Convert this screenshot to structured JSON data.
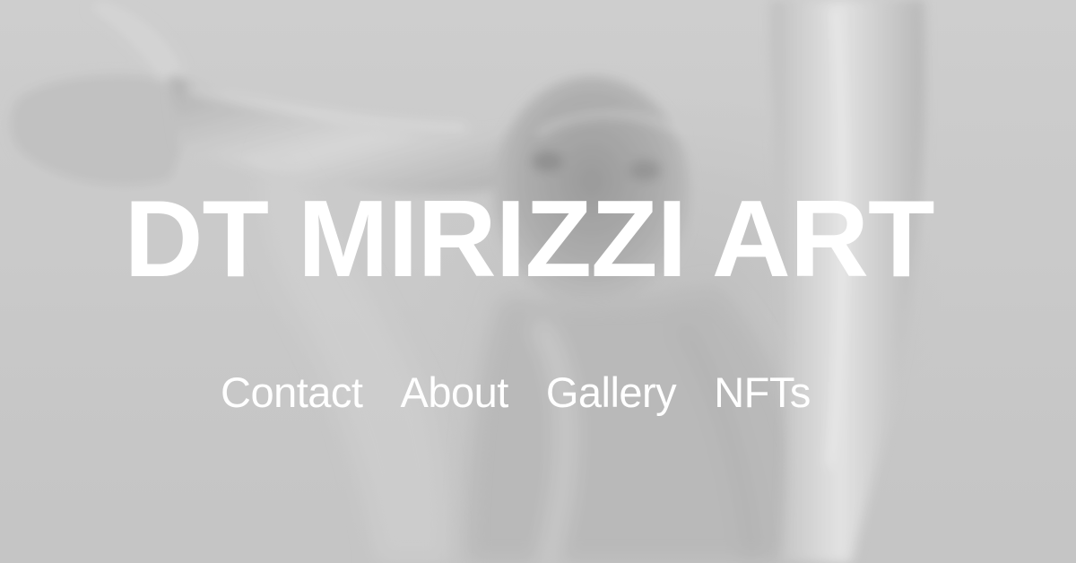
{
  "site": {
    "title": "DT MIRIZZI ART"
  },
  "nav": {
    "items": [
      {
        "label": "Contact"
      },
      {
        "label": "About"
      },
      {
        "label": "Gallery"
      },
      {
        "label": "NFTs"
      }
    ]
  },
  "colors": {
    "background": "#c9c9c9",
    "text": "#ffffff"
  }
}
